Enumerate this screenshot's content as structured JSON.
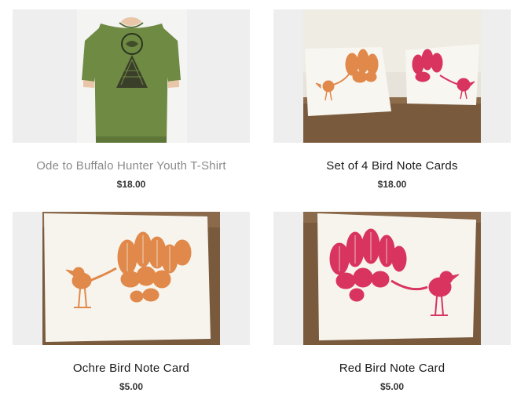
{
  "products": [
    {
      "title": "Ode to Buffalo Hunter Youth T-Shirt",
      "price": "$18.00",
      "image": "youth-tshirt-image"
    },
    {
      "title": "Set of 4 Bird Note Cards",
      "price": "$18.00",
      "image": "bird-note-cards-set-image"
    },
    {
      "title": "Ochre Bird Note Card",
      "price": "$5.00",
      "image": "ochre-bird-card-image"
    },
    {
      "title": "Red Bird Note Card",
      "price": "$5.00",
      "image": "red-bird-card-image"
    }
  ],
  "colors": {
    "thumb_bg": "#eeeeee",
    "shirt": "#6f8a43",
    "ochre": "#e0894a",
    "red": "#d8345f",
    "wood": "#7a5a3c"
  }
}
